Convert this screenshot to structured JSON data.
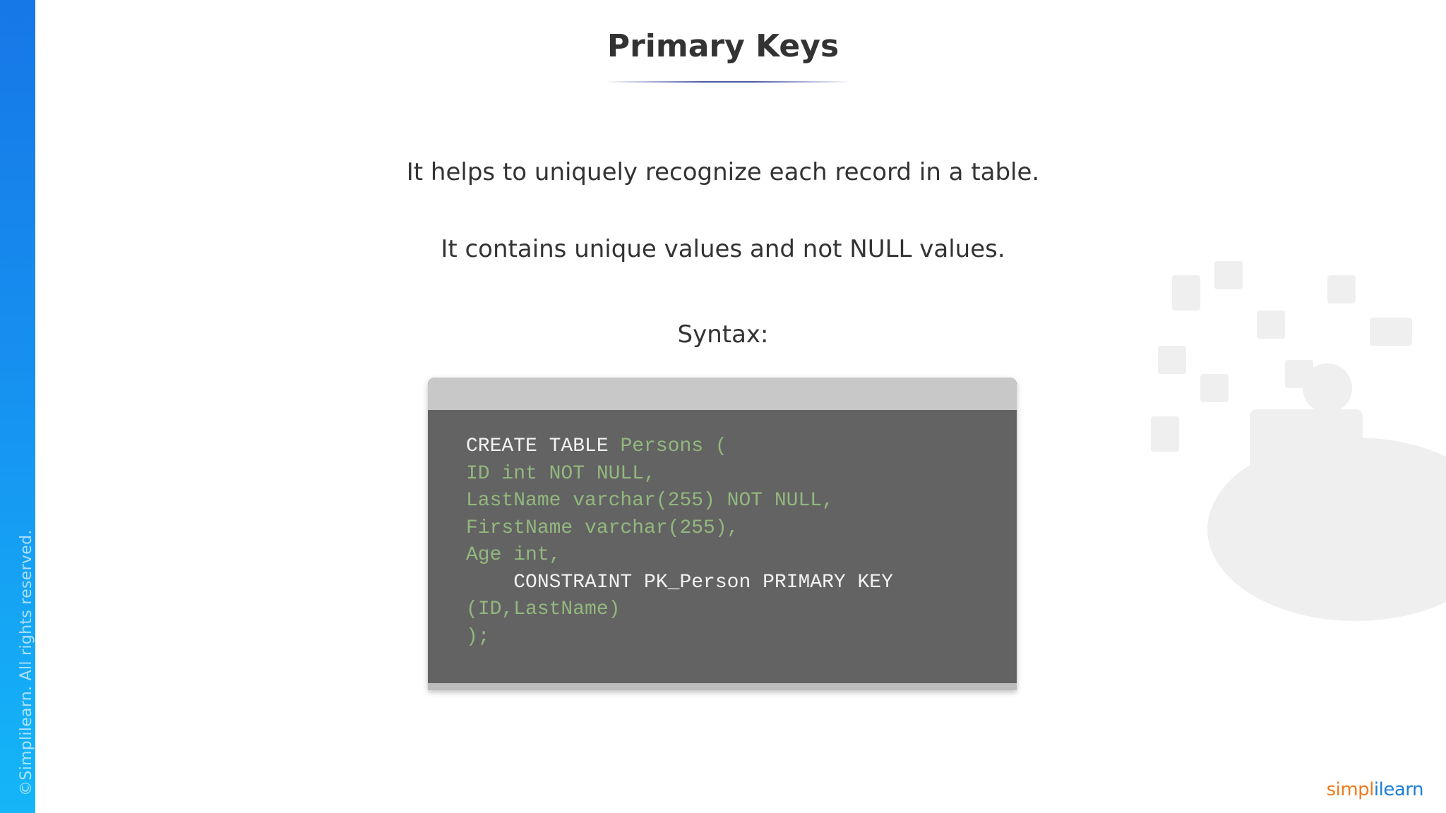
{
  "slide": {
    "title": "Primary Keys",
    "points": [
      "It helps to uniquely recognize each record in a table.",
      "It contains unique values and not NULL values."
    ],
    "syntax_label": "Syntax:",
    "code_lines": [
      [
        {
          "t": "CREATE TABLE ",
          "c": "kw"
        },
        {
          "t": "Persons (",
          "c": "lit"
        }
      ],
      [
        {
          "t": "ID int NOT NULL,",
          "c": "lit"
        }
      ],
      [
        {
          "t": "LastName varchar(255) NOT NULL,",
          "c": "lit"
        }
      ],
      [
        {
          "t": "FirstName varchar(255),",
          "c": "lit"
        }
      ],
      [
        {
          "t": "Age int,",
          "c": "lit"
        }
      ],
      [
        {
          "t": "    CONSTRAINT PK_Person PRIMARY KEY",
          "c": "kw"
        }
      ],
      [
        {
          "t": "(ID,LastName)",
          "c": "lit"
        }
      ],
      [
        {
          "t": ");",
          "c": "lit"
        }
      ]
    ]
  },
  "branding": {
    "copyright": "©Simplilearn. All rights reserved.",
    "logo_part1": "simpl",
    "logo_part2": "i",
    "logo_part3": "learn"
  },
  "colors": {
    "side_bar": "#1690f0",
    "code_keyword": "#f2f2f2",
    "code_literal": "#93b87e",
    "logo_orange": "#f07b20",
    "logo_blue": "#1a7fd8"
  }
}
